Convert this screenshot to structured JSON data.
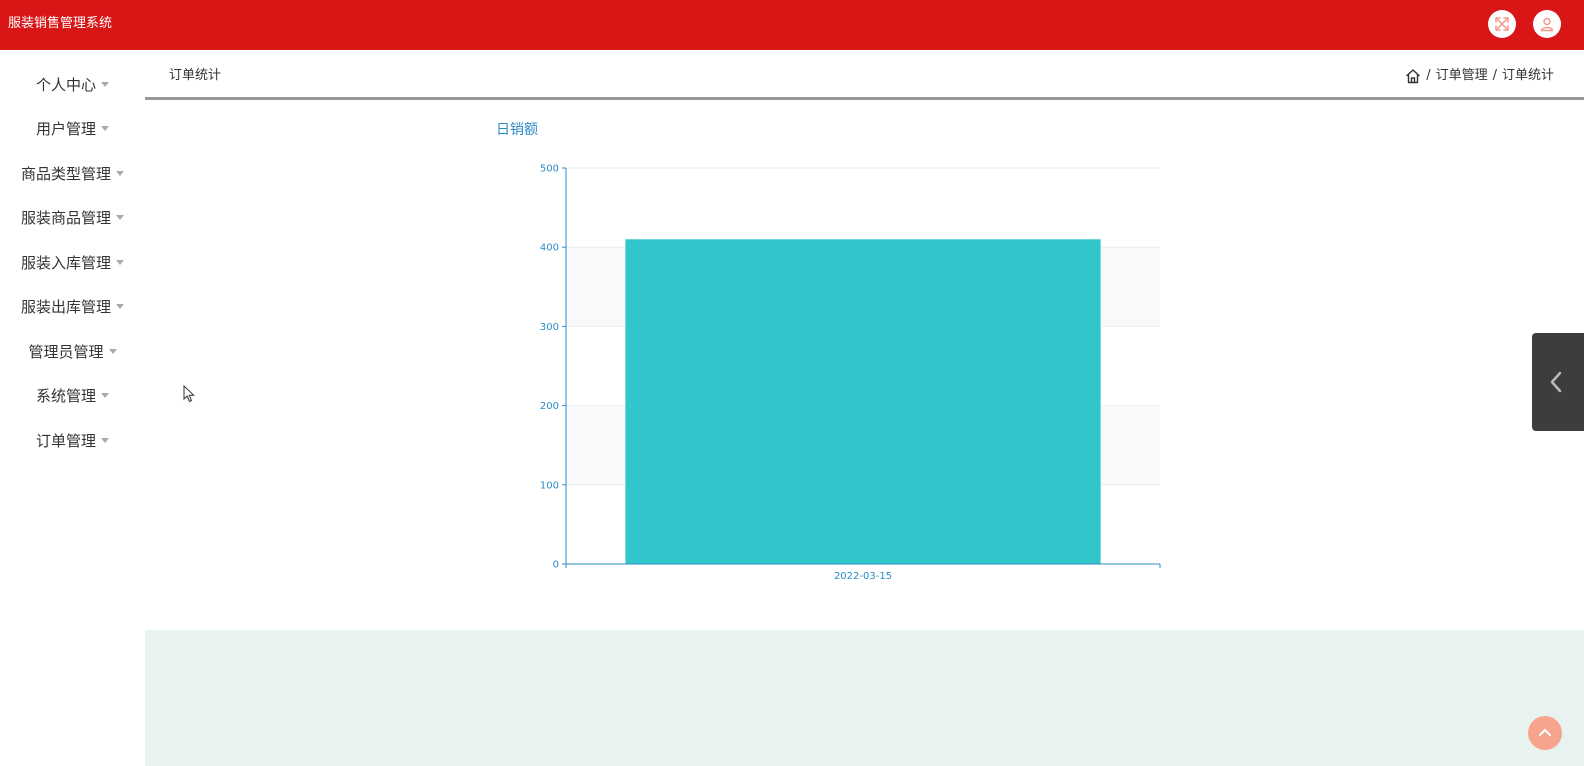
{
  "app": {
    "title": "服装销售管理系统"
  },
  "colors": {
    "topbar": "#d91616",
    "accent": "#2c8cc5",
    "bar": "#31c6cc",
    "footer": "#e8f2ee"
  },
  "topbar": {
    "icons": [
      "fullscreen-icon",
      "user-icon"
    ]
  },
  "sidebar": {
    "items": [
      {
        "label": "个人中心"
      },
      {
        "label": "用户管理"
      },
      {
        "label": "商品类型管理"
      },
      {
        "label": "服装商品管理"
      },
      {
        "label": "服装入库管理"
      },
      {
        "label": "服装出库管理"
      },
      {
        "label": "管理员管理"
      },
      {
        "label": "系统管理"
      },
      {
        "label": "订单管理"
      }
    ]
  },
  "header": {
    "title": "订单统计",
    "breadcrumb": {
      "home_icon": "home-icon",
      "separator": "/",
      "level1": "订单管理",
      "level2": "订单统计"
    }
  },
  "chart_data": {
    "type": "bar",
    "title": "日销额",
    "categories": [
      "2022-03-15"
    ],
    "values": [
      410
    ],
    "ylim": [
      0,
      500
    ],
    "yticks": [
      0,
      100,
      200,
      300,
      400,
      500
    ],
    "grid": true,
    "xlabel": "",
    "ylabel": ""
  }
}
